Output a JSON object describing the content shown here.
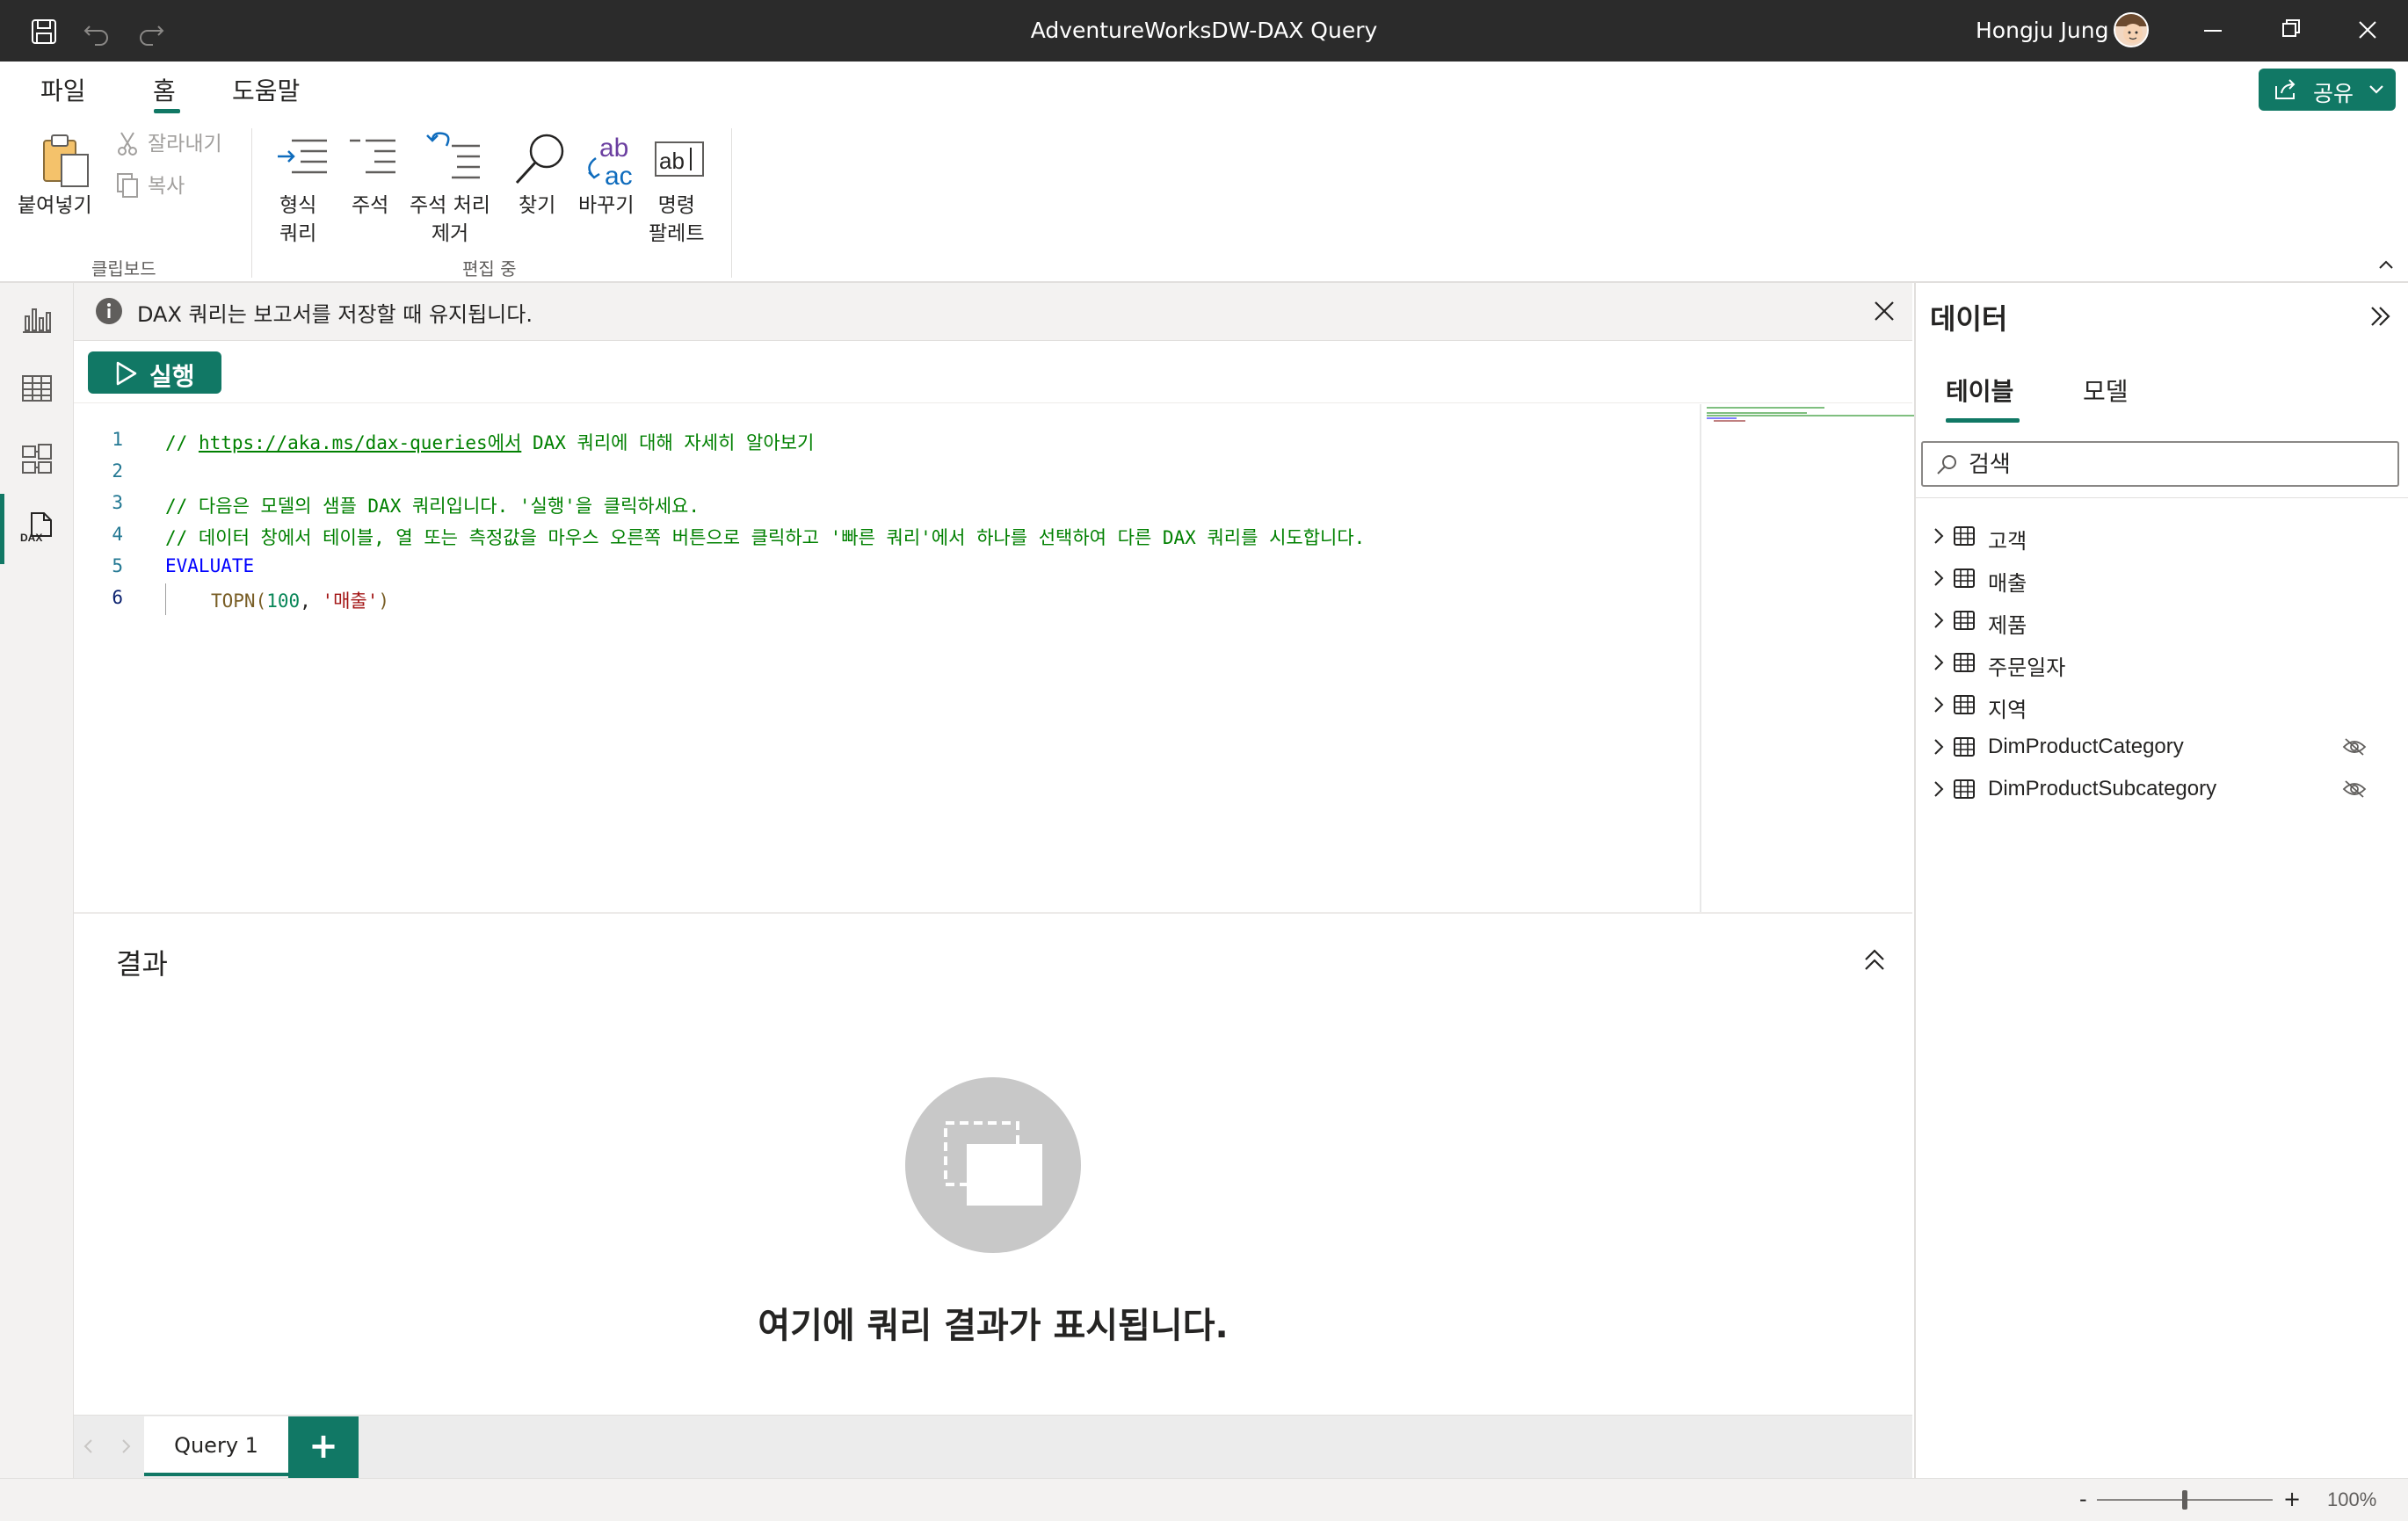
{
  "window": {
    "title": "AdventureWorksDW-DAX Query",
    "user_name": "Hongju Jung"
  },
  "ribbon": {
    "tabs": [
      "파일",
      "홈",
      "도움말"
    ],
    "active_tab": "홈",
    "share_label": "공유",
    "clipboard": {
      "paste": "붙여넣기",
      "cut": "잘라내기",
      "copy": "복사",
      "group_label": "클립보드"
    },
    "editing": {
      "format_query_l1": "형식",
      "format_query_l2": "쿼리",
      "comment": "주석",
      "uncomment_l1": "주석 처리",
      "uncomment_l2": "제거",
      "find": "찾기",
      "replace": "바꾸기",
      "command_palette_l1": "명령",
      "command_palette_l2": "팔레트",
      "group_label": "편집 중"
    }
  },
  "info_banner": {
    "text": "DAX 쿼리는 보고서를 저장할 때 유지됩니다."
  },
  "run_button": {
    "label": "실행"
  },
  "editor": {
    "line_numbers": [
      "1",
      "2",
      "3",
      "4",
      "5",
      "6"
    ],
    "line1_prefix": "// ",
    "line1_link": "https://aka.ms/dax-queries에서",
    "line1_suffix": " DAX 쿼리에 대해 자세히 알아보기",
    "line3": "// 다음은 모델의 샘플 DAX 쿼리입니다. '실행'을 클릭하세요.",
    "line4": "// 데이터 창에서 테이블, 열 또는 측정값을 마우스 오른쪽 버튼으로 클릭하고 '빠른 쿼리'에서 하나를 선택하여 다른 DAX 쿼리를 시도합니다.",
    "line5": "EVALUATE",
    "line6_fn": "TOPN(",
    "line6_num": "100",
    "line6_sep": ", ",
    "line6_str": "'매출'",
    "line6_close": ")"
  },
  "results": {
    "title": "결과",
    "empty_message": "여기에 쿼리 결과가 표시됩니다."
  },
  "query_tabs": {
    "tabs": [
      "Query 1"
    ],
    "add_label": "+"
  },
  "data_pane": {
    "title": "데이터",
    "tabs": [
      "테이블",
      "모델"
    ],
    "active_tab": "테이블",
    "search_placeholder": "검색",
    "tables": [
      {
        "name": "고객",
        "hidden": false
      },
      {
        "name": "매출",
        "hidden": false
      },
      {
        "name": "제품",
        "hidden": false
      },
      {
        "name": "주문일자",
        "hidden": false
      },
      {
        "name": "지역",
        "hidden": false
      },
      {
        "name": "DimProductCategory",
        "hidden": true
      },
      {
        "name": "DimProductSubcategory",
        "hidden": true
      }
    ]
  },
  "status_bar": {
    "zoom_minus": "-",
    "zoom_plus": "+",
    "zoom": "100%",
    "zoom_level": 1.0
  },
  "colors": {
    "accent": "#117865",
    "titlebar": "#2b2b2b",
    "comment": "#008000",
    "keyword": "#0000ff",
    "string": "#a31515",
    "number": "#098658",
    "line_number": "#237893"
  },
  "icons": {
    "save": "save-icon",
    "undo": "undo-icon",
    "redo": "redo-icon",
    "minimize": "minimize-icon",
    "restore": "restore-icon",
    "close": "close-icon",
    "info": "info-icon",
    "play": "play-icon",
    "chevron_right": "chevron-right-icon",
    "table": "table-icon",
    "hidden": "eye-off-icon",
    "search": "search-icon",
    "collapse_up": "double-chevron-up-icon",
    "collapse_pane": "double-chevron-right-icon"
  }
}
